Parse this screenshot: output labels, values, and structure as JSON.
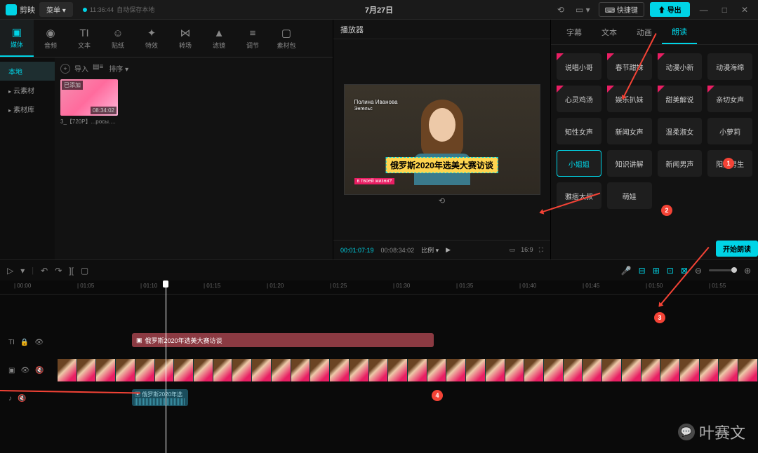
{
  "app": {
    "name": "剪映",
    "menu": "菜单",
    "save_time": "11:36:44",
    "save_txt": "自动保存本地",
    "title": "7月27日",
    "shortcut": "快捷键",
    "export": "导出"
  },
  "tool_tabs": [
    {
      "label": "媒体",
      "icon": "▣"
    },
    {
      "label": "音频",
      "icon": "◉"
    },
    {
      "label": "文本",
      "icon": "TI"
    },
    {
      "label": "贴纸",
      "icon": "☺"
    },
    {
      "label": "特效",
      "icon": "✦"
    },
    {
      "label": "转场",
      "icon": "⋈"
    },
    {
      "label": "滤镜",
      "icon": "▲"
    },
    {
      "label": "调节",
      "icon": "≡"
    },
    {
      "label": "素材包",
      "icon": "▢"
    }
  ],
  "left_side": [
    {
      "label": "本地",
      "active": true
    },
    {
      "label": "云素材",
      "caret": true
    },
    {
      "label": "素材库",
      "caret": true
    }
  ],
  "import_label": "导入",
  "sort_label": "排序",
  "media": {
    "badge": "已添加",
    "duration": "08:34:02",
    "name": "3_【720P】...росы.mp4"
  },
  "player": {
    "header": "播放器",
    "caption_name": "Полина Иванова",
    "caption_city": "Энгельс",
    "title_overlay": "俄罗斯2020年选美大赛访谈",
    "subtitle": "в твоей жизни?",
    "cur": "00:01:07:19",
    "total": "00:08:34:02",
    "ratio_label": "比例",
    "ratio_icon": "16:9"
  },
  "rp_tabs": [
    {
      "label": "字幕"
    },
    {
      "label": "文本"
    },
    {
      "label": "动画"
    },
    {
      "label": "朗读",
      "active": true
    }
  ],
  "voices": [
    {
      "name": "说唱小哥",
      "vip": true
    },
    {
      "name": "春节甜妹",
      "vip": true
    },
    {
      "name": "动漫小新",
      "vip": true
    },
    {
      "name": "动漫海绵"
    },
    {
      "name": "心灵鸡汤",
      "vip": true
    },
    {
      "name": "娱乐扒妹",
      "vip": true
    },
    {
      "name": "甜美解说",
      "vip": true
    },
    {
      "name": "亲切女声",
      "vip": true
    },
    {
      "name": "知性女声"
    },
    {
      "name": "新闻女声"
    },
    {
      "name": "温柔淑女"
    },
    {
      "name": "小萝莉"
    },
    {
      "name": "小姐姐",
      "selected": true
    },
    {
      "name": "知识讲解"
    },
    {
      "name": "新闻男声"
    },
    {
      "name": "阳光男生"
    },
    {
      "name": "雅痞大叔"
    },
    {
      "name": "萌娃"
    }
  ],
  "start_read": "开始朗读",
  "ruler": [
    "00:00",
    "01:05",
    "01:10",
    "01:15",
    "01:20",
    "01:25",
    "01:30",
    "01:35",
    "01:40",
    "01:45",
    "01:50",
    "01:55"
  ],
  "text_clip": "俄罗斯2020年选美大赛访谈",
  "audio_clip": "俄罗斯2020年选",
  "annotations": [
    "1",
    "2",
    "3",
    "4"
  ],
  "watermark": "叶赛文"
}
